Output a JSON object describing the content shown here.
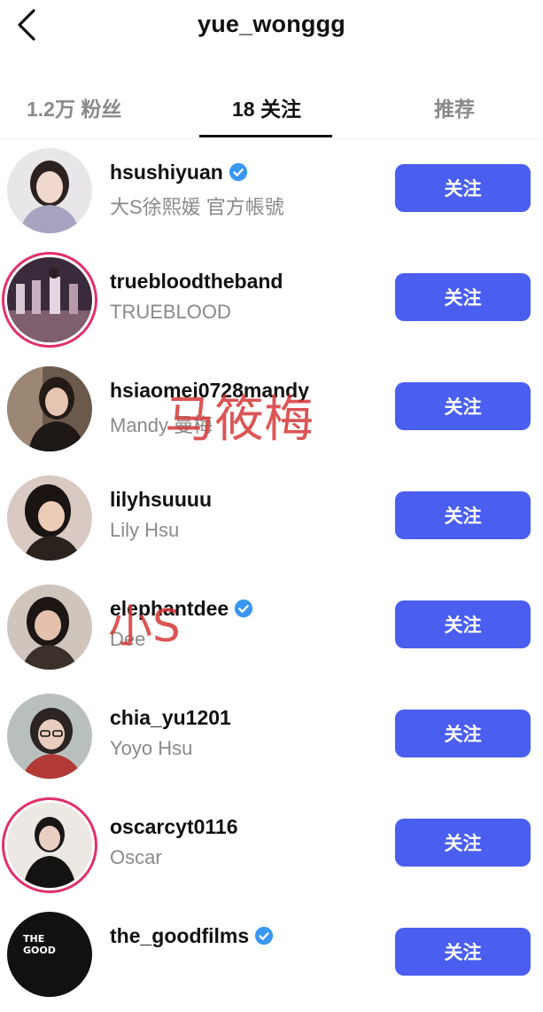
{
  "header": {
    "title": "yue_wonggg",
    "back_icon": "chevron-left-icon"
  },
  "tabs": [
    {
      "label": "1.2万 粉丝",
      "active": false
    },
    {
      "label": "18 关注",
      "active": true
    },
    {
      "label": "推荐",
      "active": false
    }
  ],
  "accounts": [
    {
      "username": "hsushiyuan",
      "full_name": "大S徐熙媛 官方帳號",
      "verified": true,
      "button": "关注"
    },
    {
      "username": "truebloodtheband",
      "full_name": "TRUEBLOOD",
      "verified": false,
      "button": "关注"
    },
    {
      "username": "hsiaomei0728mandy",
      "full_name": "Mandy 曼梅",
      "verified": false,
      "button": "关注"
    },
    {
      "username": "lilyhsuuuu",
      "full_name": "Lily Hsu",
      "verified": false,
      "button": "关注"
    },
    {
      "username": "elephantdee",
      "full_name": "Dee",
      "verified": true,
      "button": "关注"
    },
    {
      "username": "chia_yu1201",
      "full_name": "Yoyo Hsu",
      "verified": false,
      "button": "关注"
    },
    {
      "username": "oscarcyt0116",
      "full_name": "Oscar",
      "verified": false,
      "button": "关注"
    },
    {
      "username": "the_goodfilms",
      "full_name": "",
      "verified": true,
      "button": "关注"
    }
  ],
  "avatar_logo_text": "THE GOOD",
  "annotations": [
    "马筱梅",
    "小S"
  ],
  "colors": {
    "follow_button": "#4a5ef0",
    "verified_badge": "#3897f0",
    "story_ring": "#e1306c",
    "annotation": "#d63737"
  }
}
